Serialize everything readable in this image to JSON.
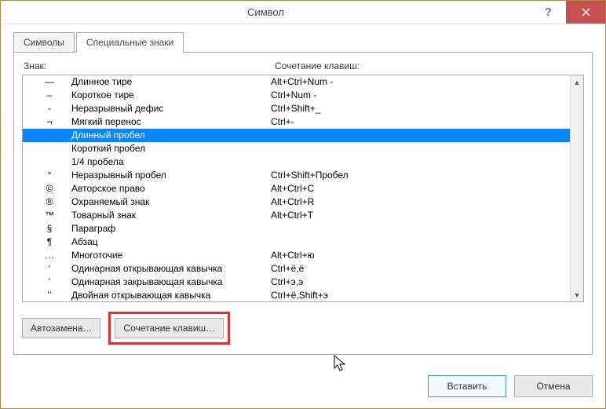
{
  "window": {
    "title": "Символ"
  },
  "tabs": {
    "symbols": "Символы",
    "special": "Специальные знаки"
  },
  "headers": {
    "sign": "Знак:",
    "shortcut": "Сочетание клавиш:"
  },
  "rows": [
    {
      "sym": "—",
      "name": "Длинное тире",
      "shortcut": "Alt+Ctrl+Num -",
      "selected": false
    },
    {
      "sym": "–",
      "name": "Короткое тире",
      "shortcut": "Ctrl+Num -",
      "selected": false
    },
    {
      "sym": "-",
      "name": "Неразрывный дефис",
      "shortcut": "Ctrl+Shift+_",
      "selected": false
    },
    {
      "sym": "¬",
      "name": "Мягкий перенос",
      "shortcut": "Ctrl+-",
      "selected": false
    },
    {
      "sym": "",
      "name": "Длинный пробел",
      "shortcut": "",
      "selected": true
    },
    {
      "sym": "",
      "name": "Короткий пробел",
      "shortcut": "",
      "selected": false
    },
    {
      "sym": "",
      "name": "1/4 пробела",
      "shortcut": "",
      "selected": false
    },
    {
      "sym": "°",
      "name": "Неразрывный пробел",
      "shortcut": "Ctrl+Shift+Пробел",
      "selected": false
    },
    {
      "sym": "©",
      "name": "Авторское право",
      "shortcut": "Alt+Ctrl+C",
      "selected": false
    },
    {
      "sym": "®",
      "name": "Охраняемый знак",
      "shortcut": "Alt+Ctrl+R",
      "selected": false
    },
    {
      "sym": "™",
      "name": "Товарный знак",
      "shortcut": "Alt+Ctrl+T",
      "selected": false
    },
    {
      "sym": "§",
      "name": "Параграф",
      "shortcut": "",
      "selected": false
    },
    {
      "sym": "¶",
      "name": "Абзац",
      "shortcut": "",
      "selected": false
    },
    {
      "sym": "…",
      "name": "Многоточие",
      "shortcut": "Alt+Ctrl+ю",
      "selected": false
    },
    {
      "sym": "‘",
      "name": "Одинарная открывающая кавычка",
      "shortcut": "Ctrl+ё,ё",
      "selected": false
    },
    {
      "sym": "’",
      "name": "Одинарная закрывающая кавычка",
      "shortcut": "Ctrl+э,э",
      "selected": false
    },
    {
      "sym": "ʼʼ",
      "name": "Двойная открывающая кавычка",
      "shortcut": "Ctrl+ё,Shift+э",
      "selected": false
    }
  ],
  "buttons": {
    "autocorrect": "Автозамена…",
    "shortcut": "Сочетание клавиш…",
    "insert": "Вставить",
    "cancel": "Отмена"
  }
}
